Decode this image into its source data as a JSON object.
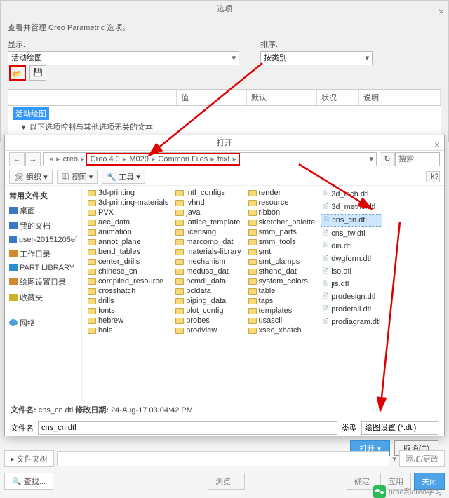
{
  "parent": {
    "title": "选项",
    "subtitle": "查看并管理 Creo Parametric 选项。",
    "display_label": "显示:",
    "display_value": "活动绘图",
    "sort_label": "排序:",
    "sort_value": "按类别",
    "grid_headers": [
      "",
      "值",
      "默认",
      "状况",
      "说明"
    ],
    "grid_row1": "活动绘图",
    "grid_row2": "▼ 以下选项控制与其他选项无关的文本"
  },
  "open": {
    "title": "打开",
    "breadcrumb_prefix": [
      "«",
      "creo"
    ],
    "breadcrumb": [
      "Creo 4.0",
      "M020",
      "Common Files",
      "text"
    ],
    "search_placeholder": "搜索...",
    "toolbar": {
      "organize": "组织",
      "view": "视图",
      "tools": "工具"
    },
    "sidebar_header": "常用文件夹",
    "sidebar": [
      {
        "label": "桌面",
        "color": "#3a78c4"
      },
      {
        "label": "我的文档",
        "color": "#3a78c4"
      },
      {
        "label": "user-20151205ef",
        "color": "#3a78c4"
      },
      {
        "label": "工作目录",
        "color": "#d08a2a"
      },
      {
        "label": "PART LIBRARY",
        "color": "#2a8fd0"
      },
      {
        "label": "绘图设置目录",
        "color": "#d08a2a"
      },
      {
        "label": "收藏夹",
        "color": "#d0b22a"
      }
    ],
    "sidebar2_header": "网络",
    "folders": [
      [
        "3d-printing",
        "3d-printing-materials",
        "PVX",
        "aec_data",
        "animation",
        "annot_plane",
        "bend_tables",
        "center_drills",
        "chinese_cn",
        "compiled_resource",
        "crosshatch",
        "drills",
        "fonts",
        "hebrew",
        "hole"
      ],
      [
        "intf_configs",
        "ivhnd",
        "java",
        "lattice_template",
        "licensing",
        "marcomp_dat",
        "materials-library",
        "mechanism",
        "medusa_dat",
        "ncmdl_data",
        "pcldata",
        "piping_data",
        "plot_config",
        "probes",
        "prodview"
      ],
      [
        "render",
        "resource",
        "ribbon",
        "sketcher_palette",
        "smm_parts",
        "smm_tools",
        "smt",
        "smt_clamps",
        "stheno_dat",
        "system_colors",
        "table",
        "taps",
        "templates",
        "usascii",
        "xsec_xhatch"
      ]
    ],
    "files": [
      "3d_inch.dtl",
      "3d_metric.dtl",
      "cns_cn.dtl",
      "cns_tw.dtl",
      "din.dtl",
      "dwgform.dtl",
      "iso.dtl",
      "jis.dtl",
      "prodesign.dtl",
      "prodetail.dtl",
      "prodiagram.dtl"
    ],
    "selected_file_index": 2,
    "status_prefix": "文件名: ",
    "status_file": "cns_cn.dtl",
    "status_mid": "  修改日期: ",
    "status_date": "24-Aug-17 03:04:42 PM",
    "fname_label": "文件名",
    "fname_value": "cns_cn.dtl",
    "type_label": "类型",
    "type_value": "绘图设置 (*.dtl)",
    "open_btn": "打开",
    "cancel_btn": "取消(C)"
  },
  "footer": {
    "tree": "▸ 文件夹树",
    "add": "添加/更改",
    "find": "🔍 查找...",
    "browse": "浏览...",
    "ok": "确定",
    "apply": "应用",
    "close": "关闭"
  },
  "wechat": "proe和creo学习"
}
